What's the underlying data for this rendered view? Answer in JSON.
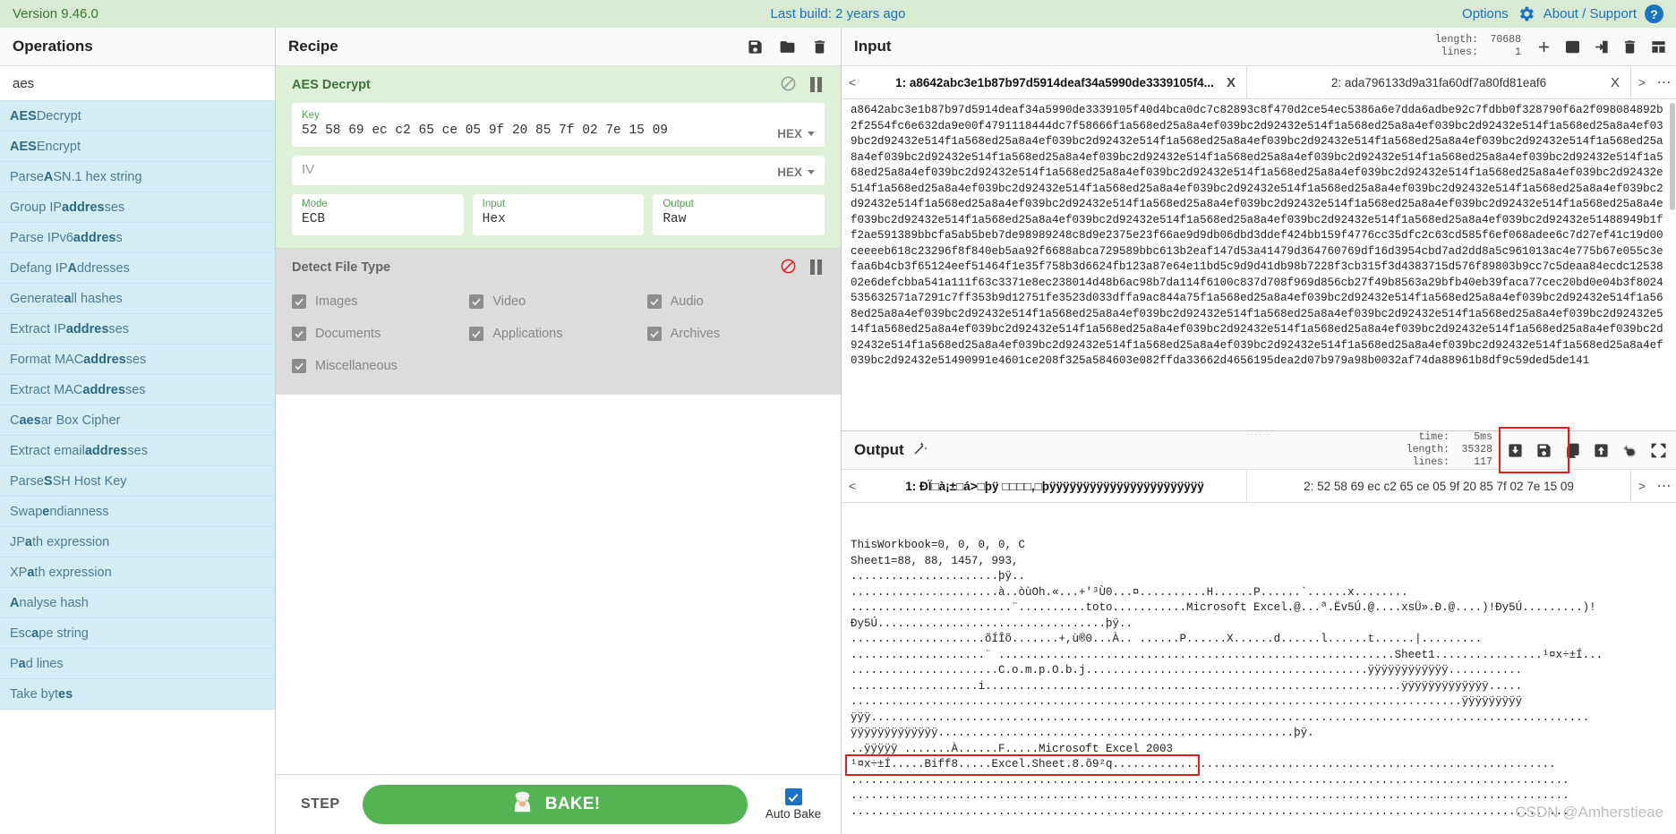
{
  "banner": {
    "version": "Version 9.46.0",
    "last_build": "Last build: 2 years ago",
    "options": "Options",
    "about": "About / Support",
    "help_glyph": "?"
  },
  "operations": {
    "title": "Operations",
    "search_value": "aes",
    "search_placeholder": "Search operations...",
    "items": [
      {
        "pre": "",
        "bold": "AES",
        "post": " Decrypt"
      },
      {
        "pre": "",
        "bold": "AES",
        "post": " Encrypt"
      },
      {
        "pre": "Parse ",
        "bold": "A",
        "post": "SN.1 hex string"
      },
      {
        "pre": "Group IP ",
        "bold": "addres",
        "post": "ses"
      },
      {
        "pre": "Parse IPv6 ",
        "bold": "addres",
        "post": "s"
      },
      {
        "pre": "Defang IP ",
        "bold": "A",
        "post": "ddresses"
      },
      {
        "pre": "Generate ",
        "bold": "a",
        "post": "ll hashes"
      },
      {
        "pre": "Extract IP ",
        "bold": "addres",
        "post": "ses"
      },
      {
        "pre": "Format MAC ",
        "bold": "addres",
        "post": "ses"
      },
      {
        "pre": "Extract MAC ",
        "bold": "addres",
        "post": "ses"
      },
      {
        "pre": "C",
        "bold": "aes",
        "post": "ar Box Cipher"
      },
      {
        "pre": "Extract email ",
        "bold": "addres",
        "post": "ses"
      },
      {
        "pre": "Parse ",
        "bold": "S",
        "post": "SH Host Key"
      },
      {
        "pre": "Swap ",
        "bold": "e",
        "post": "ndianness"
      },
      {
        "pre": "JP",
        "bold": "a",
        "post": "th expression"
      },
      {
        "pre": "XP",
        "bold": "a",
        "post": "th expression"
      },
      {
        "pre": "",
        "bold": "A",
        "post": "nalyse hash"
      },
      {
        "pre": "Esc",
        "bold": "a",
        "post": "pe string"
      },
      {
        "pre": "P",
        "bold": "a",
        "post": "d lines"
      },
      {
        "pre": "Take byt",
        "bold": "es",
        "post": ""
      }
    ]
  },
  "recipe": {
    "title": "Recipe",
    "icons": [
      "save-icon",
      "folder-icon",
      "trash-icon"
    ],
    "operations": [
      {
        "name": "AES Decrypt",
        "enabled": true,
        "fields": [
          {
            "label": "Key",
            "value": "52 58 69 ec c2 65 ce 05 9f 20 85 7f 02 7e 15 09",
            "unit": "HEX"
          },
          {
            "label": "",
            "placeholder": "IV",
            "value": "",
            "unit": "HEX"
          }
        ],
        "selects": [
          {
            "label": "Mode",
            "value": "ECB"
          },
          {
            "label": "Input",
            "value": "Hex"
          },
          {
            "label": "Output",
            "value": "Raw"
          }
        ]
      },
      {
        "name": "Detect File Type",
        "enabled": false,
        "checkboxes": [
          {
            "label": "Images",
            "checked": true
          },
          {
            "label": "Video",
            "checked": true
          },
          {
            "label": "Audio",
            "checked": true
          },
          {
            "label": "Documents",
            "checked": true
          },
          {
            "label": "Applications",
            "checked": true
          },
          {
            "label": "Archives",
            "checked": true
          },
          {
            "label": "Miscellaneous",
            "checked": true
          }
        ]
      }
    ],
    "step_label": "STEP",
    "bake_label": "BAKE!",
    "autobake_label": "Auto Bake",
    "autobake_checked": true
  },
  "input": {
    "title": "Input",
    "stats": {
      "length_label": "length:",
      "length_value": "70688",
      "lines_label": "lines:",
      "lines_value": "1"
    },
    "icons": [
      "plus-icon",
      "folder-open-icon",
      "open-folder-as-input-icon",
      "trash-icon",
      "layout-icon"
    ],
    "tabs": [
      {
        "label": "1: a8642abc3e1b87b97d5914deaf34a5990de3339105f4...",
        "active": true,
        "close": "X"
      },
      {
        "label": "2: ada796133d9a31fa60df7a80fd81eaf6",
        "active": false,
        "close": "X"
      }
    ],
    "prev_arrow": "<",
    "next_arrow": ">",
    "more": "⋯",
    "content": "a8642abc3e1b87b97d5914deaf34a5990de3339105f40d4bca0dc7c82893c8f470d2ce54ec5386a6e7dda6adbe92c7fdbb0f328790f6a2f098084892b2f2554fc6e632da9e00f4791118444dc7f58666f1a568ed25a8a4ef039bc2d92432e514f1a568ed25a8a4ef039bc2d92432e514f1a568ed25a8a4ef039bc2d92432e514f1a568ed25a8a4ef039bc2d92432e514f1a568ed25a8a4ef039bc2d92432e514f1a568ed25a8a4ef039bc2d92432e514f1a568ed25a8a4ef039bc2d92432e514f1a568ed25a8a4ef039bc2d92432e514f1a568ed25a8a4ef039bc2d92432e514f1a568ed25a8a4ef039bc2d92432e514f1a568ed25a8a4ef039bc2d92432e514f1a568ed25a8a4ef039bc2d92432e514f1a568ed25a8a4ef039bc2d92432e514f1a568ed25a8a4ef039bc2d92432e514f1a568ed25a8a4ef039bc2d92432e514f1a568ed25a8a4ef039bc2d92432e514f1a568ed25a8a4ef039bc2d92432e514f1a568ed25a8a4ef039bc2d92432e514f1a568ed25a8a4ef039bc2d92432e514f1a568ed25a8a4ef039bc2d92432e514f1a568ed25a8a4ef039bc2d92432e514f1a568ed25a8a4ef039bc2d92432e514f1a568ed25a8a4ef039bc2d92432e514f1a568ed25a8a4ef039bc2d92432e514f1a568ed25a8a4ef039bc2d92432e51488949b1ff2ae591389bbcfa5ab5beb7de98989248c8d9e2375e23f66ae9d9db06dbd3ddef424bb159f4776cc35dfc2c63cd585f6ef068adee6c7d27ef41c19d00ceeeeb618c23296f8f840eb5aa92f6688abca729589bbc613b2eaf147d53a41479d364760769df16d3954cbd7ad2dd8a5c961013ac4e775b67e055c3efaa6b4cb3f65124eef51464f1e35f758b3d6624fb123a87e64e11bd5c9d9d41db98b7228f3cb315f3d4383715d576f89803b9cc7c5deaa84ecdc1253802e6defcbba541a111f63c3371e8ec238014d48b6ac98b7da114f6100c837d708f969d856cb27f49b8563a29bfb40eb39faca77cec20bd0e04b3f8024535632571a7291c7ff353b9d12751fe3523d033dffa9ac844a75f1a568ed25a8a4ef039bc2d92432e514f1a568ed25a8a4ef039bc2d92432e514f1a568ed25a8a4ef039bc2d92432e514f1a568ed25a8a4ef039bc2d92432e514f1a568ed25a8a4ef039bc2d92432e514f1a568ed25a8a4ef039bc2d92432e514f1a568ed25a8a4ef039bc2d92432e514f1a568ed25a8a4ef039bc2d92432e514f1a568ed25a8a4ef039bc2d92432e514f1a568ed25a8a4ef039bc2d92432e514f1a568ed25a8a4ef039bc2d92432e514f1a568ed25a8a4ef039bc2d92432e514f1a568ed25a8a4ef039bc2d92432e514f1a568ed25a8a4ef039bc2d92432e51490991e4601ce208f325a584603e082ffda33662d4656195dea2d07b979a98b0032af74da88961b8df9c59ded5de141"
  },
  "output": {
    "title": "Output",
    "magic_icon": "magic-wand-icon",
    "stats": {
      "time_label": "time:",
      "time_value": "5ms",
      "length_label": "length:",
      "length_value": "35328",
      "lines_label": "lines:",
      "lines_value": "117"
    },
    "icons": [
      "save-to-file-icon",
      "save-icon",
      "copy-icon",
      "replace-input-icon",
      "undo-icon",
      "maximise-icon"
    ],
    "tabs": [
      {
        "label": "1: ÐÏ□à¡±□á>□þÿ □□□□,□þÿÿÿÿÿÿÿÿÿÿÿÿÿÿÿÿÿÿÿÿÿÿÿ",
        "active": true
      },
      {
        "label": "2: 52 58 69 ec c2 65 ce 05 9f 20 85 7f 02 7e 15 09",
        "active": false
      }
    ],
    "prev_arrow": "<",
    "next_arrow": ">",
    "more": "⋯",
    "lines": [
      "ThisWorkbook=0, 0, 0, 0, C",
      "Sheet1=88, 88, 1457, 993,",
      "......................þÿ..",
      "......................à..òùOh.«...+'³Ù0...¤..........H......P......`......x........",
      "........................¨..........toto...........Microsoft Excel.@...ª.Ëv5Ú.@....xsÜ».Ð.@....)!Ðy5Ú.........)!",
      "Ðy5Ú..................................þÿ..",
      "....................õÍÎõ.......+,ù®0...À.. ......P......X......d......l......t......|.........",
      "....................¨ ...........................................................Sheet1................¹¤x÷±Í...",
      "......................C.o.m.p.O.b.j..........................................ÿÿÿÿÿÿÿÿÿÿÿÿ...........",
      "...................i..............................................................ÿÿÿÿÿÿÿÿÿÿÿÿÿ.....",
      "...........................................................................................ÿÿÿÿÿÿÿÿÿ",
      "ÿÿÿ...........................................................................................................",
      "ÿÿÿÿÿÿÿÿÿÿÿÿÿ.....................................................þÿ.",
      "..ÿÿÿÿÿ .......À......F.....Microsoft Excel 2003",
      "¹¤x÷±Í.....Biff8.....Excel.Sheet.8.õ9²q..................................................................",
      "...........................................................................................................",
      "...........................................................................................................",
      "..........................................................................................................."
    ],
    "highlight_line_index": 14
  },
  "watermark": "CSDN @Amherstieae"
}
